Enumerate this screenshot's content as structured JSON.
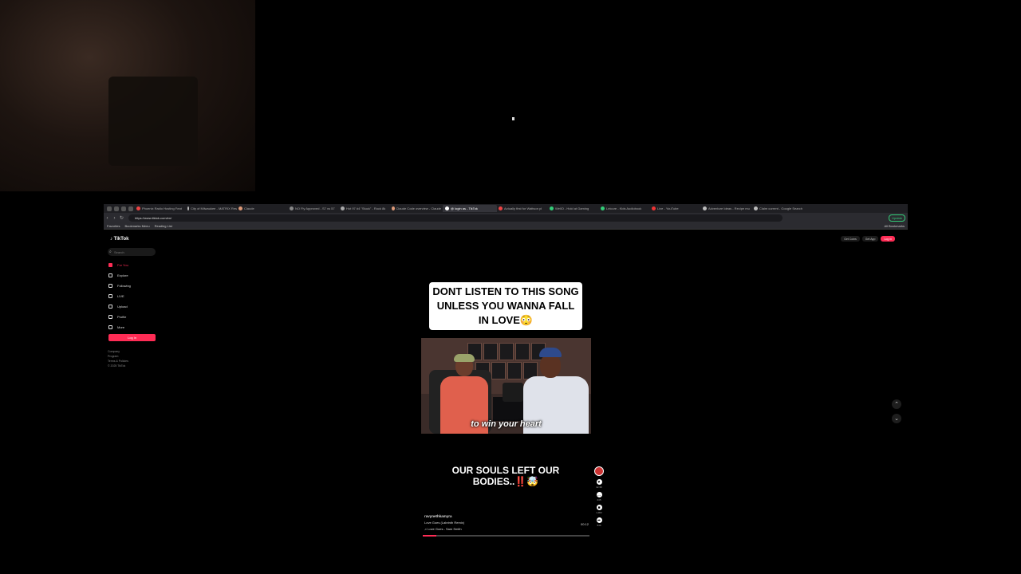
{
  "browser": {
    "tabs": [
      {
        "label": "Phoenix Radio Hosting Feat",
        "color": "#e44"
      },
      {
        "label": "City of Milwaukee - MATRIX Res",
        "color": "#bbb"
      },
      {
        "label": "Claude",
        "color": "#d97"
      },
      {
        "label": "NO Fly Approved - S7 vs 57",
        "color": "#888"
      },
      {
        "label": "Hot 97 #4 \"Stuck\" - Rock 8k",
        "color": "#aaa"
      },
      {
        "label": "Claude Code overview - Claude",
        "color": "#d97"
      },
      {
        "label": "@ login as - TikTok",
        "color": "#fff",
        "active": true
      },
      {
        "label": "Actually first for Wattson pl",
        "color": "#e44"
      },
      {
        "label": "WellO - Hold at Gaming",
        "color": "#3c7"
      },
      {
        "label": "Leicure - Kids Audiobook",
        "color": "#3c7"
      },
      {
        "label": "Live - YouTube",
        "color": "#e33"
      },
      {
        "label": "Adventure Ideas - Recipe mu",
        "color": "#bbb"
      },
      {
        "label": "Claim current - Google Search",
        "color": "#bbb"
      }
    ],
    "url": "https://www.tiktok.com/en/",
    "update_label": "Update",
    "bookmarks": [
      "Favorites",
      "Bookmarks Menu",
      "Reading List"
    ],
    "all_bookmarks": "All Bookmarks"
  },
  "tiktok": {
    "logo": "TikTok",
    "search_placeholder": "Search",
    "nav": [
      {
        "label": "For You",
        "active": true
      },
      {
        "label": "Explore"
      },
      {
        "label": "Following"
      },
      {
        "label": "LIVE"
      },
      {
        "label": "Upload"
      },
      {
        "label": "Profile"
      },
      {
        "label": "More"
      }
    ],
    "login_label": "Log in",
    "footer": [
      "Company",
      "Program",
      "Terms & Policies",
      "© 2025 TikTok"
    ],
    "top_actions": {
      "get_coins": "Get Coins",
      "get_app": "Get App",
      "login": "Log in"
    }
  },
  "video1": {
    "caption": "DONT LISTEN TO THIS SONG UNLESS YOU WANNA FALL IN LOVE😳",
    "subtitle": "to win your heart"
  },
  "video2": {
    "overlay": "OUR SOULS LEFT OUR BODIES..‼️🤯",
    "username": "ravynethkamyra",
    "description": "Love Goes (Labrinth Remix)",
    "sound": "♫ Love Goes - Sam Smith",
    "time": "00:12",
    "progress": 0.08,
    "actions": [
      {
        "icon": "heart-icon",
        "count": "12.3K"
      },
      {
        "icon": "comment-icon",
        "count": "245"
      },
      {
        "icon": "bookmark-icon",
        "count": "1,302"
      },
      {
        "icon": "share-icon",
        "count": "540"
      }
    ]
  }
}
